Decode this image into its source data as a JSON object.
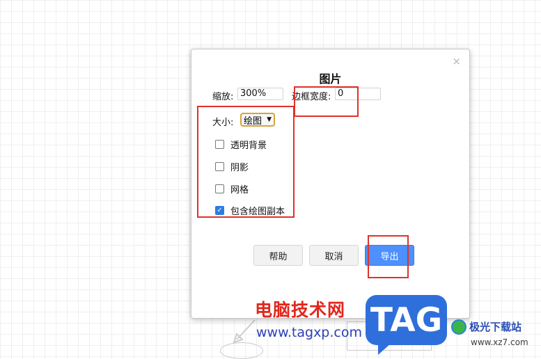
{
  "dialog": {
    "title": "图片",
    "close_symbol": "×",
    "zoom": {
      "label": "缩放:",
      "value": "300%"
    },
    "border_width": {
      "label": "边框宽度:",
      "value": "0"
    },
    "size": {
      "label": "大小:",
      "selected": "绘图"
    },
    "checkboxes": [
      {
        "label": "透明背景",
        "checked": false
      },
      {
        "label": "阴影",
        "checked": false
      },
      {
        "label": "网格",
        "checked": false
      },
      {
        "label": "包含绘图副本",
        "checked": true
      }
    ],
    "buttons": {
      "help": "帮助",
      "cancel": "取消",
      "export": "导出"
    }
  },
  "watermark": {
    "site_cn": "电脑技术网",
    "site_url": "www.tagxp.com",
    "logo": "TAG",
    "site2_cn": "极光下载站",
    "site2_url": "www.xz7.com"
  },
  "colors": {
    "highlight": "#e0312a",
    "primary_button": "#4d90fe",
    "select_border": "#d5a437"
  }
}
